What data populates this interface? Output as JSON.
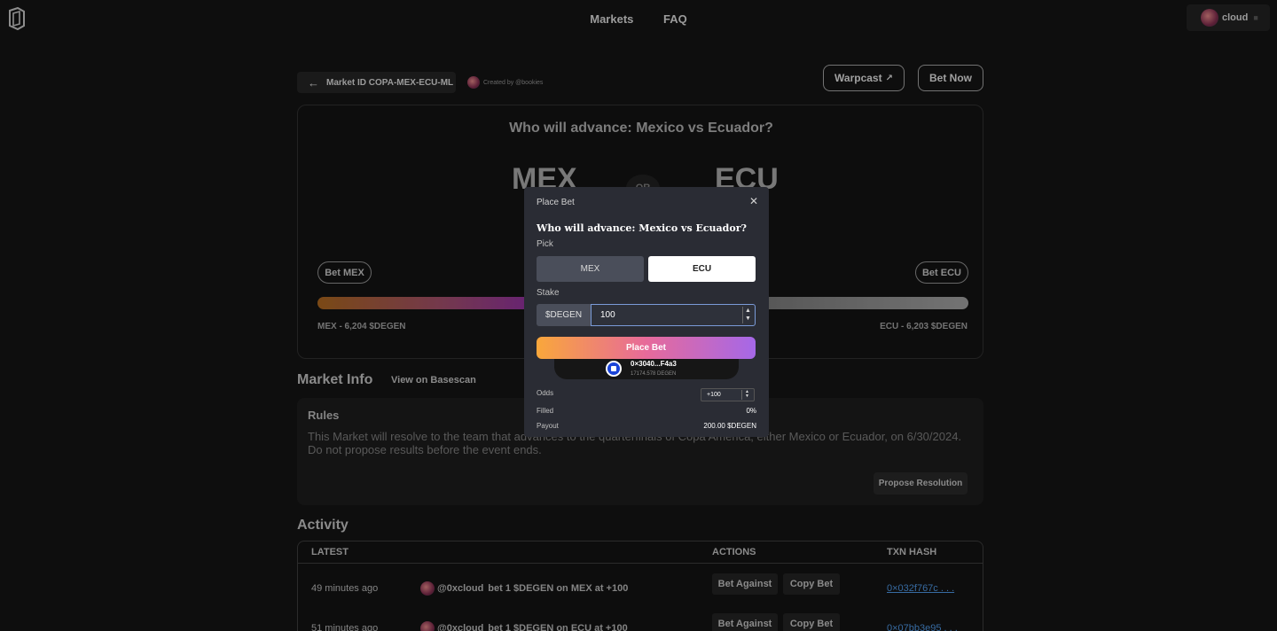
{
  "nav": {
    "links": [
      "Markets",
      "FAQ"
    ]
  },
  "user": {
    "name": "cloud"
  },
  "market": {
    "id_label": "Market ID COPA-MEX-ECU-ML",
    "creator": "Created by @bookies",
    "warpcast_label": "Warpcast",
    "bet_now_label": "Bet Now",
    "question": "Who will advance: Mexico vs Ecuador?",
    "team_a": "MEX",
    "team_b": "ECU",
    "or": "OR",
    "bet_a_label": "Bet MEX",
    "bet_b_label": "Bet ECU",
    "pool_a": "MEX - 6,204 $DEGEN",
    "pool_b": "ECU - 6,203 $DEGEN",
    "pool_split_a": 0.5
  },
  "market_info": {
    "title": "Market Info",
    "basescan_label": "View on Basescan",
    "rules_title": "Rules",
    "rules_text": "This Market will resolve to the team that advances to the quarterfinals of Copa America, either Mexico or Ecuador, on 6/30/2024. Do not propose results before the event ends.",
    "propose_label": "Propose Resolution"
  },
  "activity": {
    "title": "Activity",
    "headers": {
      "latest": "LATEST",
      "actions": "ACTIONS",
      "hash": "TXN HASH"
    },
    "rows": [
      {
        "time": "49 minutes ago",
        "user": "@0xcloud",
        "desc": "bet 1 $DEGEN on MEX at +100",
        "against": "Bet Against",
        "copy": "Copy Bet",
        "hash": "0×032f767c . . ."
      },
      {
        "time": "51 minutes ago",
        "user": "@0xcloud",
        "desc": "bet 1 $DEGEN on ECU at +100",
        "against": "Bet Against",
        "copy": "Copy Bet",
        "hash": "0×07bb3e95 . . ."
      }
    ]
  },
  "modal": {
    "title": "Place Bet",
    "question": "Who will advance: Mexico vs Ecuador?",
    "pick_label": "Pick",
    "pick_options": [
      "MEX",
      "ECU"
    ],
    "selected": "ECU",
    "stake_label": "Stake",
    "stake_unit": "$DEGEN",
    "stake_value": "100",
    "place_label": "Place Bet",
    "wallet_address": "0×3040...F4a3",
    "wallet_balance": "17174.578 DEGEN",
    "odds_label": "Odds",
    "odds_value": "+100",
    "filled_label": "Filled",
    "filled_value": "0%",
    "payout_label": "Payout",
    "payout_value": "200.00 $DEGEN"
  }
}
